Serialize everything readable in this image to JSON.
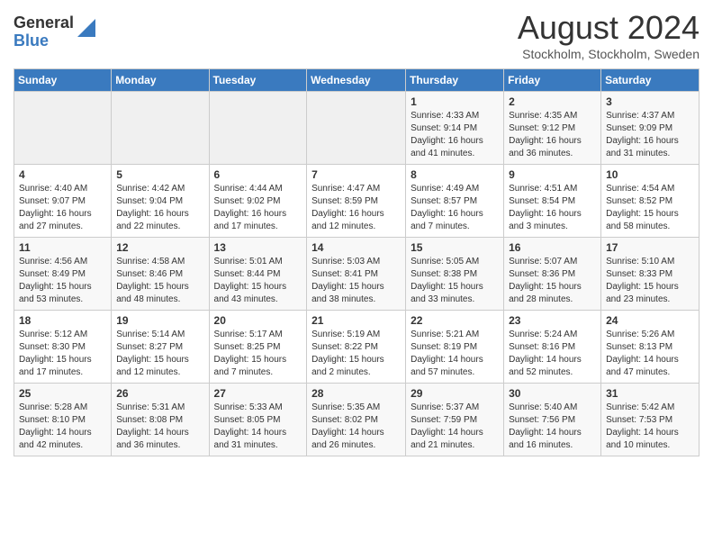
{
  "header": {
    "logo_general": "General",
    "logo_blue": "Blue",
    "month_year": "August 2024",
    "location": "Stockholm, Stockholm, Sweden"
  },
  "weekdays": [
    "Sunday",
    "Monday",
    "Tuesday",
    "Wednesday",
    "Thursday",
    "Friday",
    "Saturday"
  ],
  "weeks": [
    [
      {
        "day": "",
        "info": ""
      },
      {
        "day": "",
        "info": ""
      },
      {
        "day": "",
        "info": ""
      },
      {
        "day": "",
        "info": ""
      },
      {
        "day": "1",
        "info": "Sunrise: 4:33 AM\nSunset: 9:14 PM\nDaylight: 16 hours\nand 41 minutes."
      },
      {
        "day": "2",
        "info": "Sunrise: 4:35 AM\nSunset: 9:12 PM\nDaylight: 16 hours\nand 36 minutes."
      },
      {
        "day": "3",
        "info": "Sunrise: 4:37 AM\nSunset: 9:09 PM\nDaylight: 16 hours\nand 31 minutes."
      }
    ],
    [
      {
        "day": "4",
        "info": "Sunrise: 4:40 AM\nSunset: 9:07 PM\nDaylight: 16 hours\nand 27 minutes."
      },
      {
        "day": "5",
        "info": "Sunrise: 4:42 AM\nSunset: 9:04 PM\nDaylight: 16 hours\nand 22 minutes."
      },
      {
        "day": "6",
        "info": "Sunrise: 4:44 AM\nSunset: 9:02 PM\nDaylight: 16 hours\nand 17 minutes."
      },
      {
        "day": "7",
        "info": "Sunrise: 4:47 AM\nSunset: 8:59 PM\nDaylight: 16 hours\nand 12 minutes."
      },
      {
        "day": "8",
        "info": "Sunrise: 4:49 AM\nSunset: 8:57 PM\nDaylight: 16 hours\nand 7 minutes."
      },
      {
        "day": "9",
        "info": "Sunrise: 4:51 AM\nSunset: 8:54 PM\nDaylight: 16 hours\nand 3 minutes."
      },
      {
        "day": "10",
        "info": "Sunrise: 4:54 AM\nSunset: 8:52 PM\nDaylight: 15 hours\nand 58 minutes."
      }
    ],
    [
      {
        "day": "11",
        "info": "Sunrise: 4:56 AM\nSunset: 8:49 PM\nDaylight: 15 hours\nand 53 minutes."
      },
      {
        "day": "12",
        "info": "Sunrise: 4:58 AM\nSunset: 8:46 PM\nDaylight: 15 hours\nand 48 minutes."
      },
      {
        "day": "13",
        "info": "Sunrise: 5:01 AM\nSunset: 8:44 PM\nDaylight: 15 hours\nand 43 minutes."
      },
      {
        "day": "14",
        "info": "Sunrise: 5:03 AM\nSunset: 8:41 PM\nDaylight: 15 hours\nand 38 minutes."
      },
      {
        "day": "15",
        "info": "Sunrise: 5:05 AM\nSunset: 8:38 PM\nDaylight: 15 hours\nand 33 minutes."
      },
      {
        "day": "16",
        "info": "Sunrise: 5:07 AM\nSunset: 8:36 PM\nDaylight: 15 hours\nand 28 minutes."
      },
      {
        "day": "17",
        "info": "Sunrise: 5:10 AM\nSunset: 8:33 PM\nDaylight: 15 hours\nand 23 minutes."
      }
    ],
    [
      {
        "day": "18",
        "info": "Sunrise: 5:12 AM\nSunset: 8:30 PM\nDaylight: 15 hours\nand 17 minutes."
      },
      {
        "day": "19",
        "info": "Sunrise: 5:14 AM\nSunset: 8:27 PM\nDaylight: 15 hours\nand 12 minutes."
      },
      {
        "day": "20",
        "info": "Sunrise: 5:17 AM\nSunset: 8:25 PM\nDaylight: 15 hours\nand 7 minutes."
      },
      {
        "day": "21",
        "info": "Sunrise: 5:19 AM\nSunset: 8:22 PM\nDaylight: 15 hours\nand 2 minutes."
      },
      {
        "day": "22",
        "info": "Sunrise: 5:21 AM\nSunset: 8:19 PM\nDaylight: 14 hours\nand 57 minutes."
      },
      {
        "day": "23",
        "info": "Sunrise: 5:24 AM\nSunset: 8:16 PM\nDaylight: 14 hours\nand 52 minutes."
      },
      {
        "day": "24",
        "info": "Sunrise: 5:26 AM\nSunset: 8:13 PM\nDaylight: 14 hours\nand 47 minutes."
      }
    ],
    [
      {
        "day": "25",
        "info": "Sunrise: 5:28 AM\nSunset: 8:10 PM\nDaylight: 14 hours\nand 42 minutes."
      },
      {
        "day": "26",
        "info": "Sunrise: 5:31 AM\nSunset: 8:08 PM\nDaylight: 14 hours\nand 36 minutes."
      },
      {
        "day": "27",
        "info": "Sunrise: 5:33 AM\nSunset: 8:05 PM\nDaylight: 14 hours\nand 31 minutes."
      },
      {
        "day": "28",
        "info": "Sunrise: 5:35 AM\nSunset: 8:02 PM\nDaylight: 14 hours\nand 26 minutes."
      },
      {
        "day": "29",
        "info": "Sunrise: 5:37 AM\nSunset: 7:59 PM\nDaylight: 14 hours\nand 21 minutes."
      },
      {
        "day": "30",
        "info": "Sunrise: 5:40 AM\nSunset: 7:56 PM\nDaylight: 14 hours\nand 16 minutes."
      },
      {
        "day": "31",
        "info": "Sunrise: 5:42 AM\nSunset: 7:53 PM\nDaylight: 14 hours\nand 10 minutes."
      }
    ]
  ]
}
